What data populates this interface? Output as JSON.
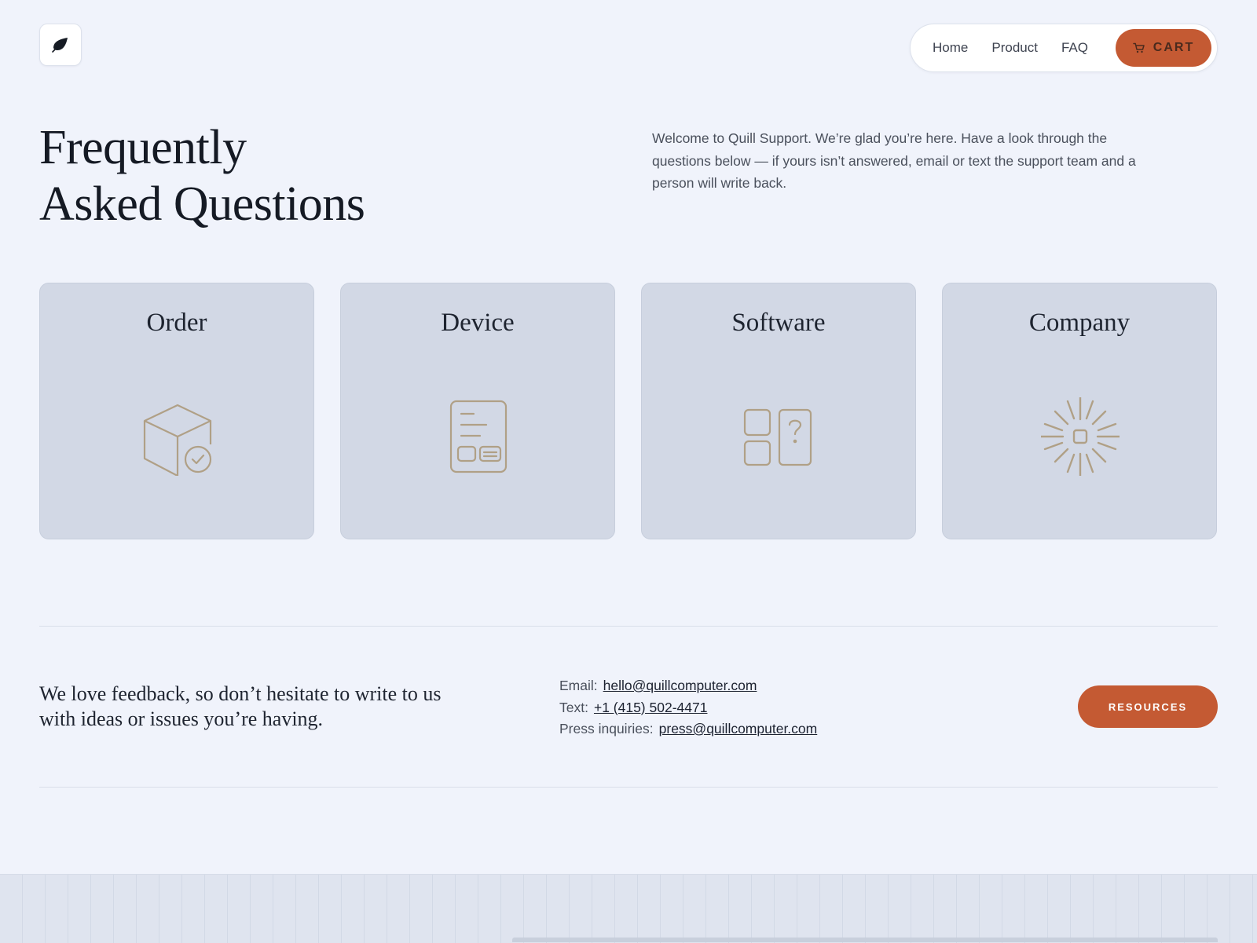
{
  "brand": {
    "logo_icon": "quill-leaf-icon"
  },
  "nav": {
    "items": [
      "Home",
      "Product",
      "FAQ"
    ],
    "cart_label": "CART",
    "cart_icon": "cart-icon"
  },
  "hero": {
    "title_line1": "Frequently",
    "title_line2": "Asked Questions",
    "intro": "Welcome to Quill Support. We’re glad you’re here. Have a look through the questions below — if yours isn’t answered, email or text the support team and a person will write back."
  },
  "categories": [
    {
      "label": "Order",
      "icon": "package-check-icon"
    },
    {
      "label": "Device",
      "icon": "device-document-icon"
    },
    {
      "label": "Software",
      "icon": "apps-question-icon"
    },
    {
      "label": "Company",
      "icon": "sunburst-icon"
    }
  ],
  "contact": {
    "feedback": "We love feedback, so don’t hesitate to write to us with ideas or issues you’re having.",
    "email_label": "Email:",
    "email": "hello@quillcomputer.com",
    "text_label": "Text:",
    "phone": "+1 (415) 502-4471",
    "press_label": "Press inquiries:",
    "press_email": "press@quillcomputer.com",
    "resources_label": "RESOURCES"
  },
  "colors": {
    "accent": "#c45a33",
    "background": "#f0f3fb",
    "card": "#d2d8e5",
    "icon_stroke": "#b0a086"
  }
}
